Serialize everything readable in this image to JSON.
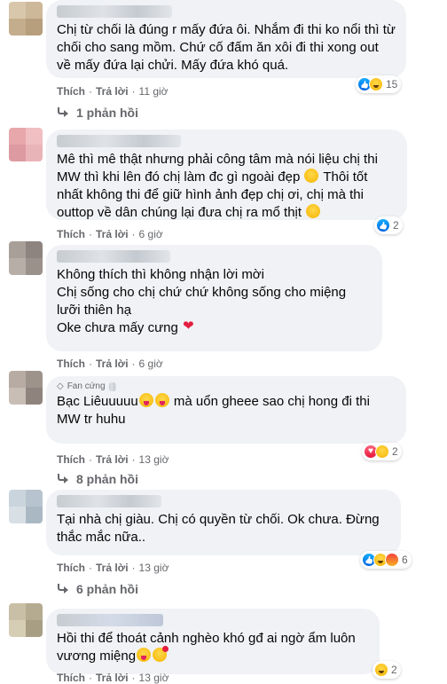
{
  "comments": [
    {
      "text": "Chị từ chối là đúng r mấy đứa ôi. Nhắm đi thi ko nổi thì từ chối cho sang mồm. Chứ cố đấm ăn xôi đi thi xong out về mấy đứa lại chửi. Mấy đứa khó quá.",
      "like": "Thích",
      "reply": "Trả lời",
      "time": "11 giờ",
      "reaction_count": "15",
      "replies": "1 phản hồi"
    },
    {
      "text": "Mê thì mê thật nhưng phải công tâm mà nói liệu chị thi MW thì khi lên đó chị làm đc gì ngoài đẹp",
      "text2": " Thôi tốt nhất không thi để giữ hình ảnh đẹp chị ơi, chị mà thi outtop về dân chúng lại đưa chị ra mổ thịt",
      "like": "Thích",
      "reply": "Trả lời",
      "time": "6 giờ",
      "reaction_count": "2"
    },
    {
      "line1": "Không thích thì không nhận lời mời",
      "line2": "Chị sống cho chị chứ chứ không sống cho miệng lưỡi thiên hạ",
      "line3": "Oke chưa mấy cưng",
      "like": "Thích",
      "reply": "Trả lời",
      "time": "6 giờ"
    },
    {
      "badge": "Fan cứng",
      "text": "Bạc Liêuuuuu",
      "text2": " mà uổn gheee sao chị hong đi thi MW tr huhu",
      "like": "Thích",
      "reply": "Trả lời",
      "time": "13 giờ",
      "reaction_count": "2",
      "replies": "8 phản hồi"
    },
    {
      "text": "Tại nhà chị giàu. Chị có quyền từ chối. Ok chưa. Đừng thắc mắc nữa..",
      "like": "Thích",
      "reply": "Trả lời",
      "time": "13 giờ",
      "reaction_count": "6",
      "replies": "6 phản hồi"
    },
    {
      "text": "Hồi thi để thoát cảnh nghèo khó gđ ai ngờ ẩm luôn vương miệng",
      "like": "Thích",
      "reply": "Trả lời",
      "time": "13 giờ",
      "reaction_count": "2"
    }
  ]
}
